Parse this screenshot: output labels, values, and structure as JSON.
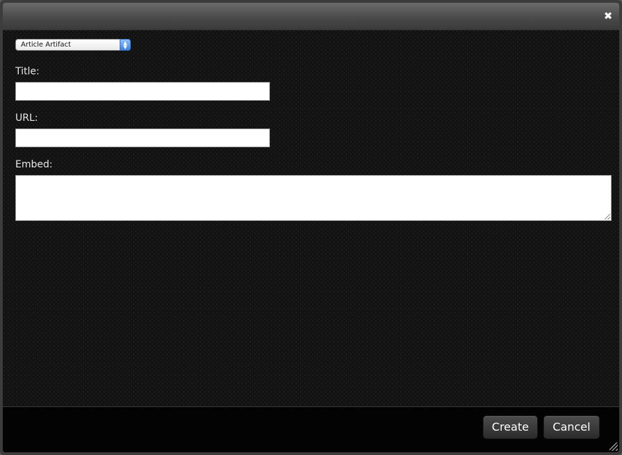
{
  "dialog": {
    "close_icon": "close-icon",
    "close_glyph": "✖"
  },
  "form": {
    "type_select": {
      "selected": "Article Artifact",
      "stepper_up": "▲",
      "stepper_down": "▼"
    },
    "title": {
      "label": "Title:",
      "value": "",
      "placeholder": ""
    },
    "url": {
      "label": "URL:",
      "value": "",
      "placeholder": ""
    },
    "embed": {
      "label": "Embed:",
      "value": "",
      "placeholder": ""
    }
  },
  "footer": {
    "create_label": "Create",
    "cancel_label": "Cancel"
  }
}
